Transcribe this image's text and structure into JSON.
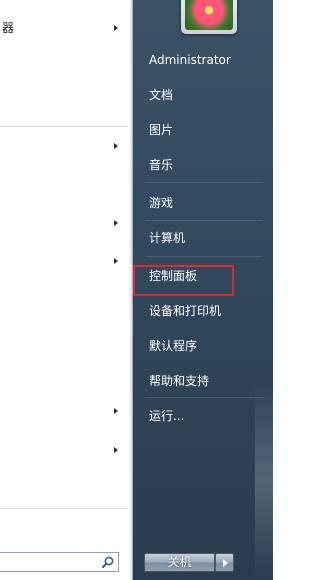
{
  "left_menu": {
    "items": [
      {
        "label": "器",
        "has_submenu": true
      },
      {
        "label": "",
        "has_submenu": true
      },
      {
        "label": "",
        "has_submenu": true
      },
      {
        "label": "",
        "has_submenu": true
      },
      {
        "label": "",
        "has_submenu": true
      },
      {
        "label": "",
        "has_submenu": true
      }
    ],
    "search": {
      "placeholder": "",
      "icon": "search-icon"
    }
  },
  "user": {
    "name": "Administrator",
    "avatar": "flower-avatar"
  },
  "right_menu": {
    "documents": "文档",
    "pictures": "图片",
    "music": "音乐",
    "games": "游戏",
    "computer": "计算机",
    "control_panel": "控制面板",
    "devices_printers": "设备和打印机",
    "default_programs": "默认程序",
    "help_support": "帮助和支持",
    "run": "运行..."
  },
  "shutdown": {
    "label": "关机",
    "arrow_icon": "chevron-right-icon"
  },
  "colors": {
    "highlight": "#e02834",
    "panel_bg": "#3c5267"
  }
}
